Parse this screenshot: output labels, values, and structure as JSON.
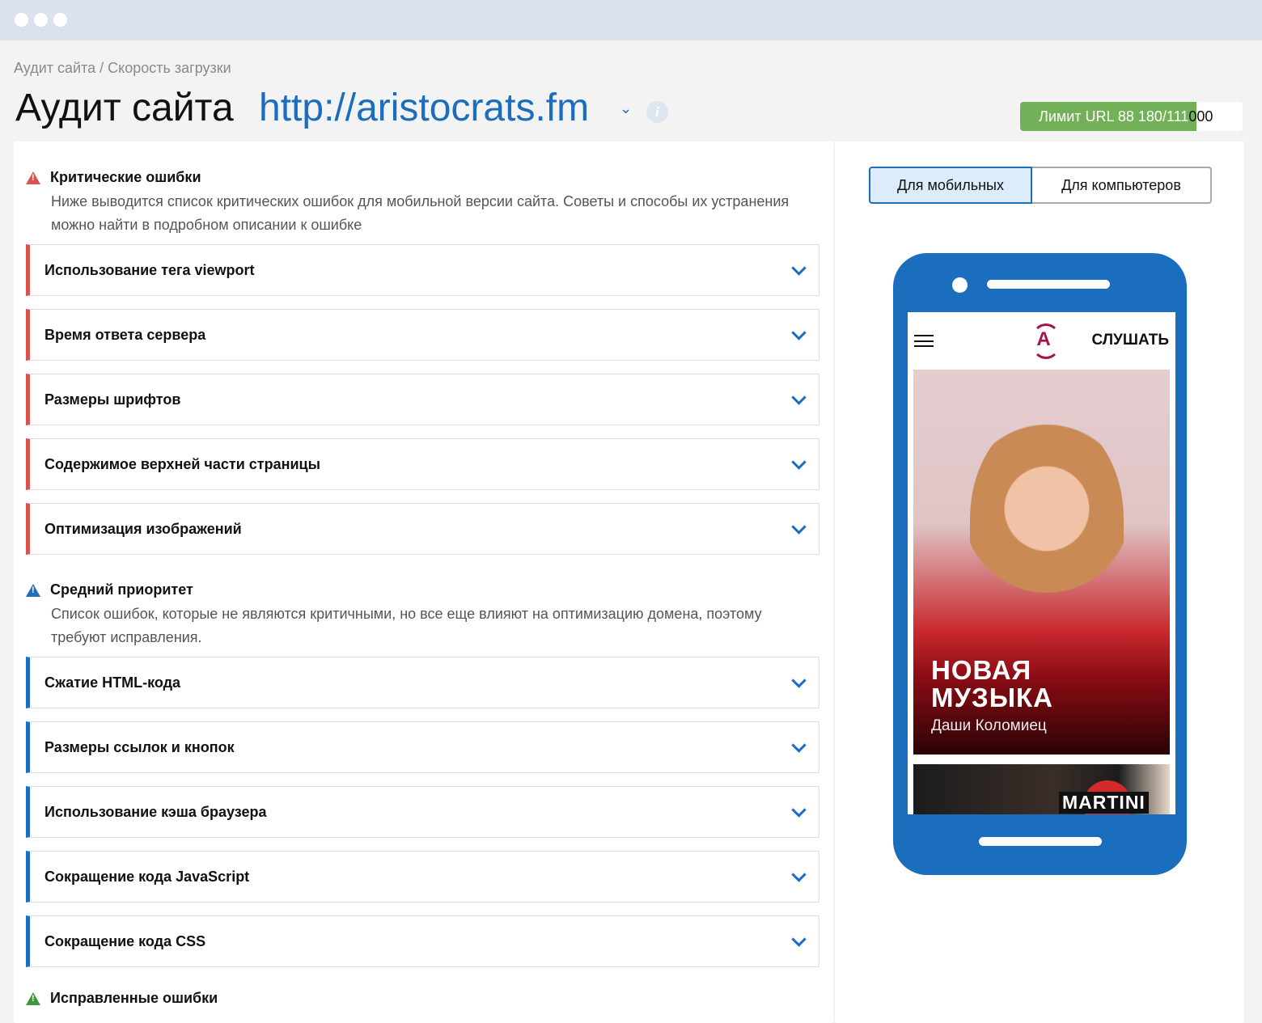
{
  "breadcrumb": "Аудит сайта / Скорость загрузки",
  "title": "Аудит сайта",
  "site_url": "http://aristocrats.fm",
  "info_icon": "i",
  "limit": {
    "label": "Лимит URL 88 180/111",
    "label_rest": "000",
    "used": 88180,
    "total": 111000,
    "color": "#73b158"
  },
  "critical": {
    "heading": "Критические ошибки",
    "description": "Ниже выводится список критических ошибок для мобильной версии сайта. Советы и способы их устранения можно найти в подробном описании к ошибке",
    "color": "#d9534f",
    "items": [
      "Использование тега viewport",
      "Время ответа сервера",
      "Размеры шрифтов",
      "Содержимое верхней части страницы",
      "Оптимизация изображений"
    ]
  },
  "medium": {
    "heading": "Средний приоритет",
    "description": "Список ошибок, которые не являются критичными, но все еще влияют на оптимизацию домена, поэтому требуют исправления.",
    "color": "#1b6ebd",
    "items": [
      "Сжатие HTML-кода",
      "Размеры ссылок и кнопок",
      "Использование кэша браузера",
      "Сокращение кода JavaScript",
      "Сокращение кода CSS"
    ]
  },
  "fixed": {
    "heading": "Исправленные ошибки",
    "color": "#3a9a3a"
  },
  "device_toggle": {
    "mobile": "Для мобильных",
    "desktop": "Для компьютеров",
    "selected": "mobile"
  },
  "preview": {
    "logo": "A",
    "listen": "СЛУШАТЬ",
    "hero_title_1": "НОВАЯ",
    "hero_title_2": "МУЗЫКА",
    "hero_subtitle": "Даши Коломиец",
    "banner_brand": "MARTINI"
  }
}
